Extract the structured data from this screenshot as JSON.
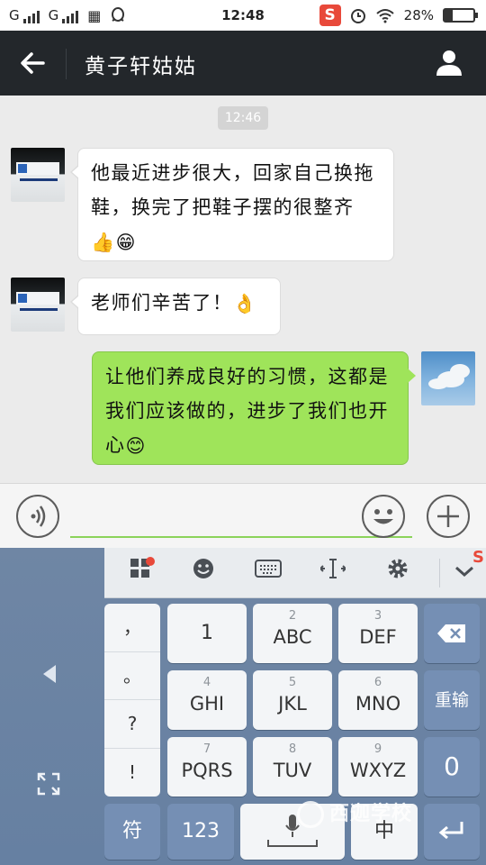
{
  "status_bar": {
    "carrier1": "G",
    "carrier2": "G",
    "time": "12:48",
    "battery": "28%",
    "battery_level": 0.28,
    "icons": [
      "signal-icon",
      "signal-icon",
      "keyboard-notify-icon",
      "qq-icon",
      "sogou-icon",
      "alarm-icon",
      "wifi-icon",
      "battery-icon"
    ]
  },
  "header": {
    "title": "黄子轩姑姑"
  },
  "chat": {
    "timestamp": "12:46",
    "messages": [
      {
        "side": "left",
        "text": "他最近进步很大，回家自己换拖鞋，换完了把鞋子摆的很整齐",
        "emoji": "👍😁"
      },
      {
        "side": "left",
        "text": "老师们辛苦了！",
        "emoji": "👌"
      },
      {
        "side": "right",
        "text": "让他们养成良好的习惯，这都是我们应该做的，进步了我们也开心",
        "emoji": "😊"
      }
    ]
  },
  "input": {
    "placeholder": ""
  },
  "keyboard": {
    "toolbar_icons": [
      "apps-icon",
      "emoji-icon",
      "keyboard-icon",
      "cursor-icon",
      "settings-icon",
      "collapse-icon"
    ],
    "punctuation": [
      "，",
      "。",
      "?",
      "!"
    ],
    "keys": [
      {
        "sub": "",
        "main": "1"
      },
      {
        "sub": "2",
        "main": "ABC"
      },
      {
        "sub": "3",
        "main": "DEF"
      },
      {
        "sub": "4",
        "main": "GHI"
      },
      {
        "sub": "5",
        "main": "JKL"
      },
      {
        "sub": "6",
        "main": "MNO"
      },
      {
        "sub": "7",
        "main": "PQRS"
      },
      {
        "sub": "8",
        "main": "TUV"
      },
      {
        "sub": "9",
        "main": "WXYZ"
      }
    ],
    "reinput": "重输",
    "zero": "0",
    "symbol": "符",
    "num": "123",
    "lang": "中",
    "watermark": "西迦学校"
  }
}
